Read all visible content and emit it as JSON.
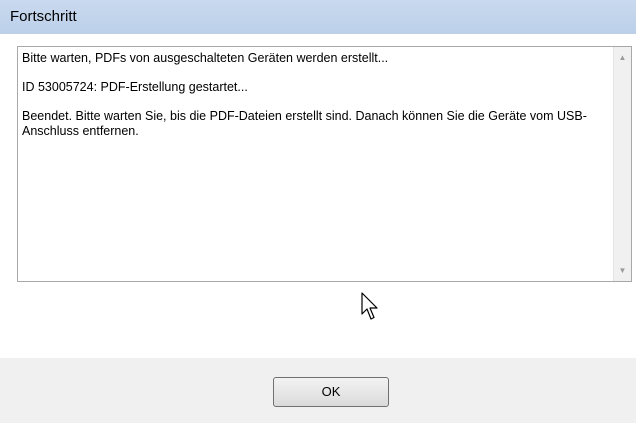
{
  "window": {
    "title": "Fortschritt"
  },
  "log": {
    "lines": [
      "Bitte warten, PDFs von ausgeschalteten Geräten werden erstellt...",
      "ID 53005724:  PDF-Erstellung gestartet...",
      "Beendet. Bitte warten Sie, bis die PDF-Dateien erstellt sind. Danach können Sie die Geräte vom USB-Anschluss entfernen."
    ]
  },
  "scrollbar": {
    "up_icon": "▲",
    "down_icon": "▼"
  },
  "footer": {
    "ok_label": "OK"
  }
}
